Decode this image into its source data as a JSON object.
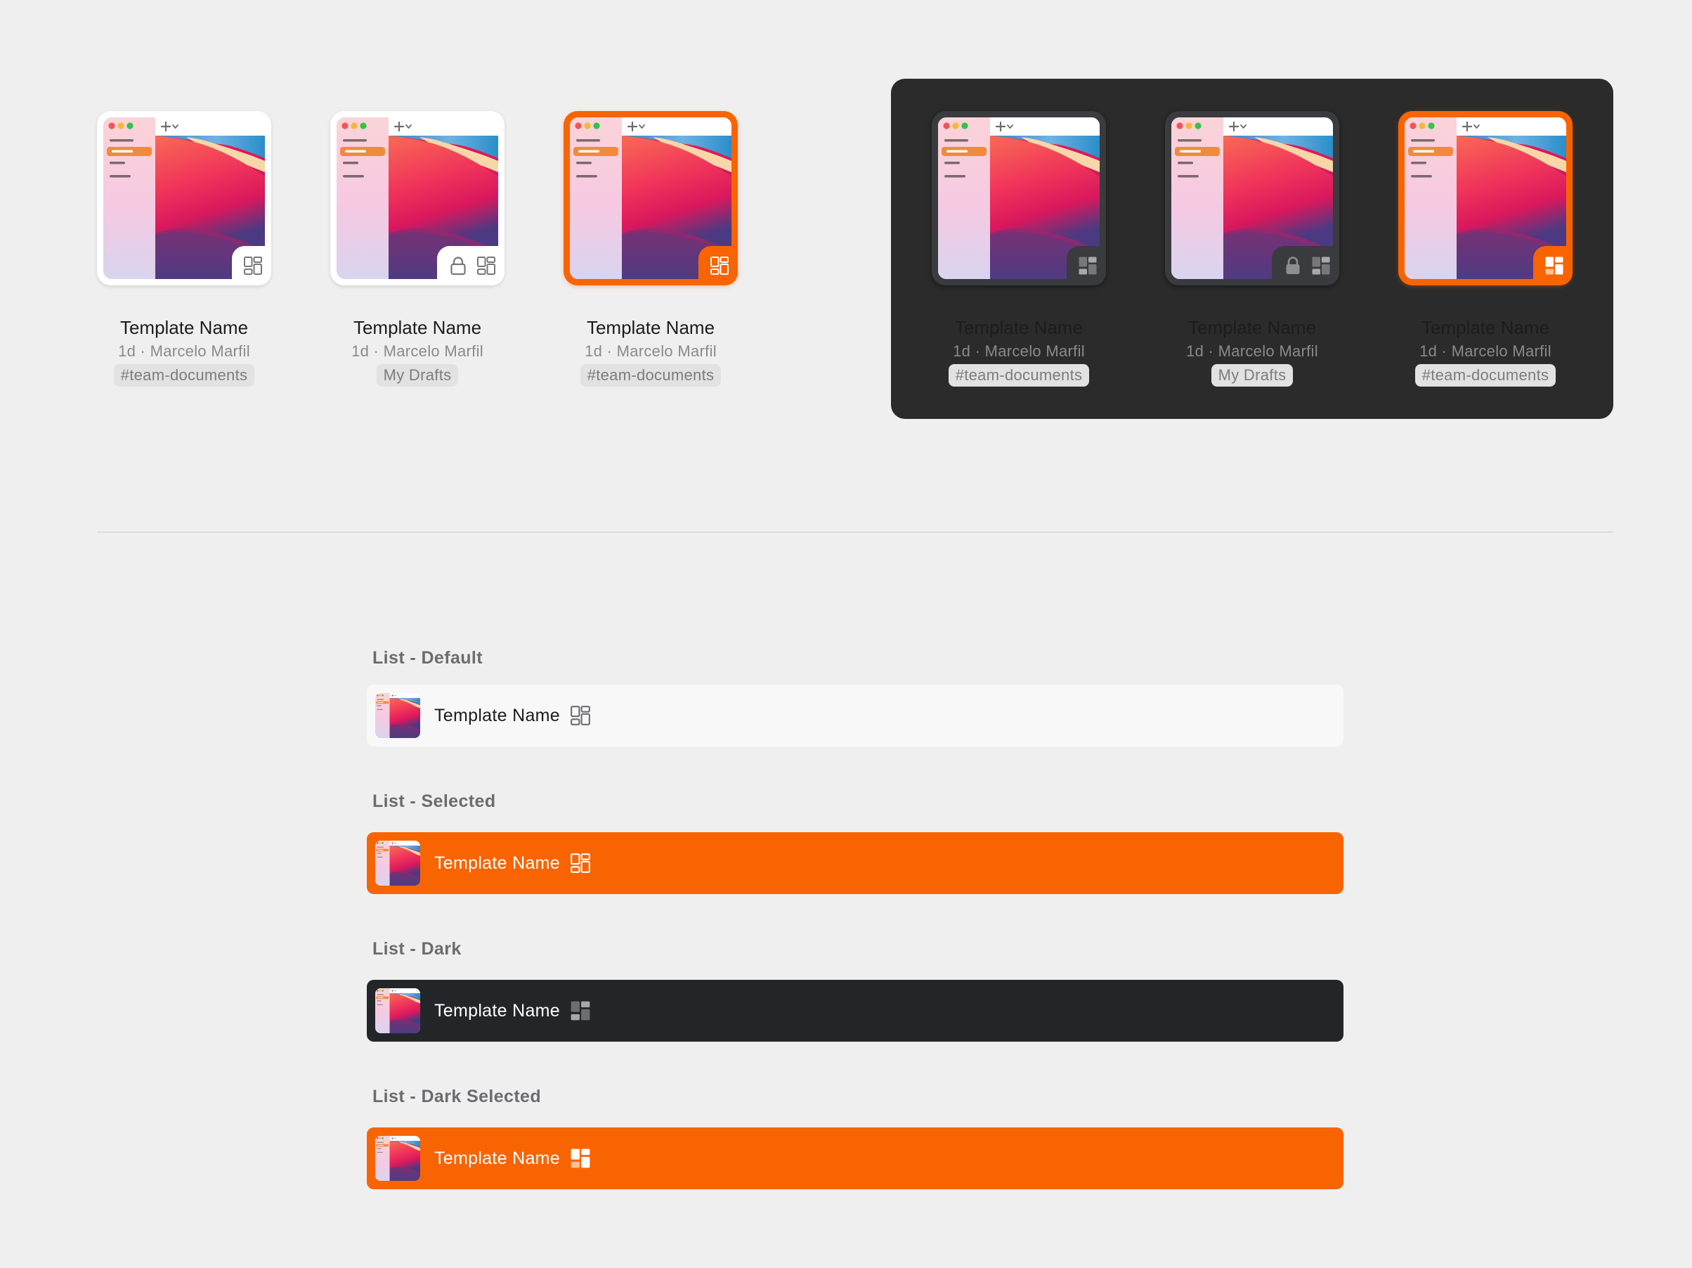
{
  "colors": {
    "background": "#efefef",
    "accent": "#f96402",
    "dark_panel": "#2b2b2c",
    "dark_row": "#232629",
    "default_row": "#f8f8f8"
  },
  "grid_light": [
    {
      "title": "Template Name",
      "meta": "1d · Marcelo Marfil",
      "tag": "#team-documents",
      "locked": false,
      "state": "default"
    },
    {
      "title": "Template Name",
      "meta": "1d · Marcelo Marfil",
      "tag": "My Drafts",
      "locked": true,
      "state": "default"
    },
    {
      "title": "Template Name",
      "meta": "1d · Marcelo Marfil",
      "tag": "#team-documents",
      "locked": false,
      "state": "selected"
    }
  ],
  "grid_dark": [
    {
      "title": "Template Name",
      "meta": "1d · Marcelo Marfil",
      "tag": "#team-documents",
      "locked": false,
      "state": "dark"
    },
    {
      "title": "Template Name",
      "meta": "1d · Marcelo Marfil",
      "tag": "My Drafts",
      "locked": true,
      "state": "dark"
    },
    {
      "title": "Template Name",
      "meta": "1d · Marcelo Marfil",
      "tag": "#team-documents",
      "locked": false,
      "state": "dark-selected"
    }
  ],
  "lists": [
    {
      "label": "List - Default",
      "name": "Template Name",
      "state": "default"
    },
    {
      "label": "List - Selected",
      "name": "Template Name",
      "state": "selected"
    },
    {
      "label": "List - Dark",
      "name": "Template Name",
      "state": "dark"
    },
    {
      "label": "List - Dark Selected",
      "name": "Template Name",
      "state": "dark-selected"
    }
  ],
  "icons": {
    "template": "template-layout-icon",
    "lock": "lock-icon",
    "new_tab": "plus-icon",
    "chevron": "chevron-down-icon"
  }
}
